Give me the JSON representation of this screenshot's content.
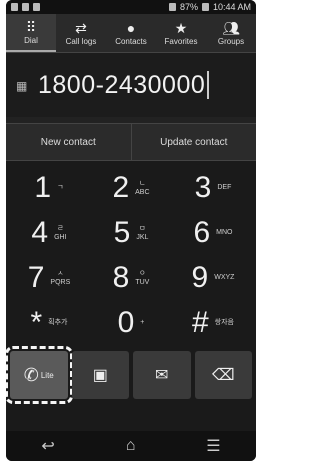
{
  "status": {
    "battery": "87%",
    "time": "10:44 AM"
  },
  "tabs": [
    {
      "label": "Dial",
      "icon": "keypad-icon"
    },
    {
      "label": "Call logs",
      "icon": "swap-icon"
    },
    {
      "label": "Contacts",
      "icon": "person-icon"
    },
    {
      "label": "Favorites",
      "icon": "star-icon"
    },
    {
      "label": "Groups",
      "icon": "group-icon"
    }
  ],
  "dialer": {
    "number": "1800-2430000"
  },
  "actions": {
    "new_contact": "New contact",
    "update_contact": "Update contact"
  },
  "keys": [
    {
      "digit": "1",
      "sub1": "ㄱ",
      "sub2": ""
    },
    {
      "digit": "2",
      "sub1": "ㄴ",
      "sub2": "ABC"
    },
    {
      "digit": "3",
      "sub1": "",
      "sub2": "DEF"
    },
    {
      "digit": "4",
      "sub1": "ㄹ",
      "sub2": "GHI"
    },
    {
      "digit": "5",
      "sub1": "ㅁ",
      "sub2": "JKL"
    },
    {
      "digit": "6",
      "sub1": "",
      "sub2": "MNO"
    },
    {
      "digit": "7",
      "sub1": "ㅅ",
      "sub2": "PQRS"
    },
    {
      "digit": "8",
      "sub1": "ㅇ",
      "sub2": "TUV"
    },
    {
      "digit": "9",
      "sub1": "",
      "sub2": "WXYZ"
    },
    {
      "digit": "*",
      "sub1": "획추가",
      "sub2": ""
    },
    {
      "digit": "0",
      "sub1": "+",
      "sub2": ""
    },
    {
      "digit": "#",
      "sub1": "쌍자음",
      "sub2": ""
    }
  ],
  "bottom": {
    "call_label": "Lite"
  }
}
